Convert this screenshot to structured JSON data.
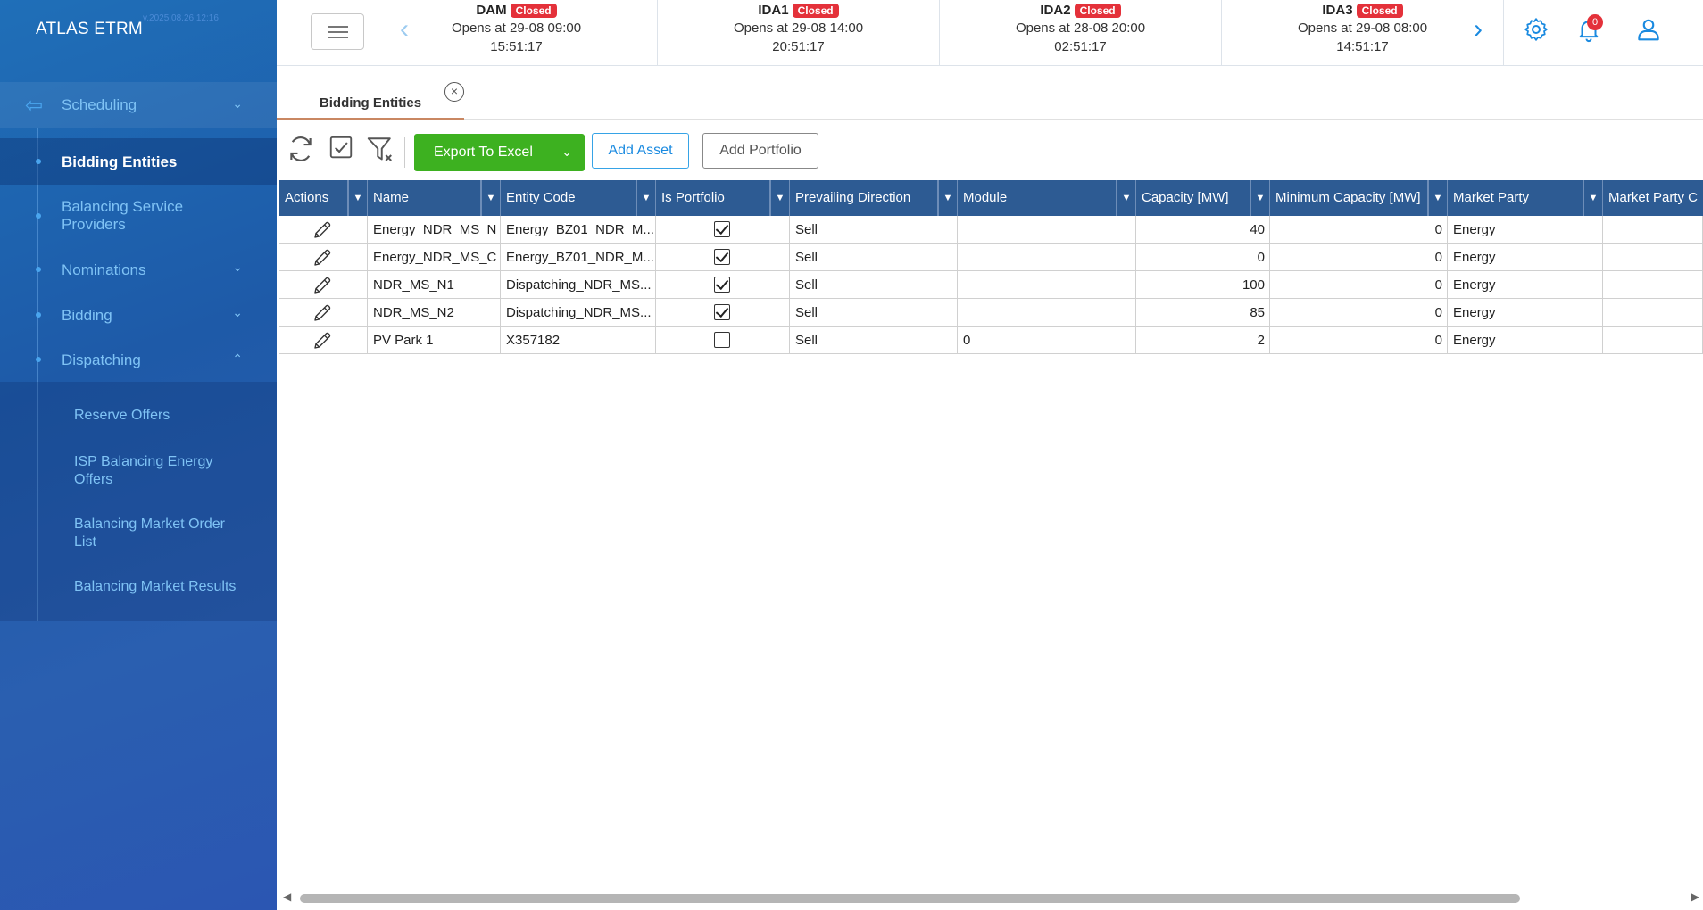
{
  "app": {
    "title": "ATLAS ETRM",
    "version": "v.2025.08.26.12:16"
  },
  "sidebar": {
    "scheduling": {
      "label": "Scheduling"
    },
    "items": [
      {
        "label": "Bidding Entities"
      },
      {
        "label": "Balancing Service Providers"
      },
      {
        "label": "Nominations"
      },
      {
        "label": "Bidding"
      },
      {
        "label": "Dispatching"
      }
    ],
    "sub_items": [
      {
        "label": "Reserve Offers"
      },
      {
        "label": "ISP Balancing Energy Offers"
      },
      {
        "label": "Balancing Market Order List"
      },
      {
        "label": "Balancing Market Results"
      }
    ]
  },
  "markets": [
    {
      "name": "DAM",
      "status": "Closed",
      "opens": "Opens at 29-08 09:00",
      "countdown": "15:51:17"
    },
    {
      "name": "IDA1",
      "status": "Closed",
      "opens": "Opens at 29-08 14:00",
      "countdown": "20:51:17"
    },
    {
      "name": "IDA2",
      "status": "Closed",
      "opens": "Opens at 28-08 20:00",
      "countdown": "02:51:17"
    },
    {
      "name": "IDA3",
      "status": "Closed",
      "opens": "Opens at 29-08 08:00",
      "countdown": "14:51:17"
    }
  ],
  "notifications": {
    "count": "0"
  },
  "tabs": [
    {
      "label": "Bidding Entities"
    }
  ],
  "toolbar": {
    "export_label": "Export To Excel",
    "add_asset_label": "Add Asset",
    "add_portfolio_label": "Add Portfolio"
  },
  "grid": {
    "columns": [
      "Actions",
      "Name",
      "Entity Code",
      "Is Portfolio",
      "Prevailing Direction",
      "Module",
      "Capacity [MW]",
      "Minimum Capacity [MW]",
      "Market Party",
      "Market Party C"
    ],
    "rows": [
      {
        "name": "Energy_NDR_MS_N",
        "entity_code": "Energy_BZ01_NDR_M...",
        "is_portfolio": true,
        "direction": "Sell",
        "module": "",
        "capacity": "40",
        "min_capacity": "0",
        "market_party": "Energy",
        "market_party_c": ""
      },
      {
        "name": "Energy_NDR_MS_C",
        "entity_code": "Energy_BZ01_NDR_M...",
        "is_portfolio": true,
        "direction": "Sell",
        "module": "",
        "capacity": "0",
        "min_capacity": "0",
        "market_party": "Energy",
        "market_party_c": ""
      },
      {
        "name": "NDR_MS_N1",
        "entity_code": "Dispatching_NDR_MS...",
        "is_portfolio": true,
        "direction": "Sell",
        "module": "",
        "capacity": "100",
        "min_capacity": "0",
        "market_party": "Energy",
        "market_party_c": ""
      },
      {
        "name": "NDR_MS_N2",
        "entity_code": "Dispatching_NDR_MS...",
        "is_portfolio": true,
        "direction": "Sell",
        "module": "",
        "capacity": "85",
        "min_capacity": "0",
        "market_party": "Energy",
        "market_party_c": ""
      },
      {
        "name": "PV Park 1",
        "entity_code": "X357182",
        "is_portfolio": false,
        "direction": "Sell",
        "module": "0",
        "capacity": "2",
        "min_capacity": "0",
        "market_party": "Energy",
        "market_party_c": ""
      }
    ]
  },
  "icons": {
    "menu": "hamburger-icon",
    "prev": "chevron-left-icon",
    "next": "chevron-right-icon",
    "settings": "gear-icon",
    "bell": "bell-icon",
    "user": "user-icon",
    "refresh": "refresh-icon",
    "check": "checkbox-icon",
    "clear_filter": "filter-clear-icon",
    "edit": "pencil-icon"
  },
  "colors": {
    "accent": "#1a8ae0",
    "export_green": "#3db120",
    "header_blue": "#2d5b93",
    "closed_red": "#e4313a"
  }
}
